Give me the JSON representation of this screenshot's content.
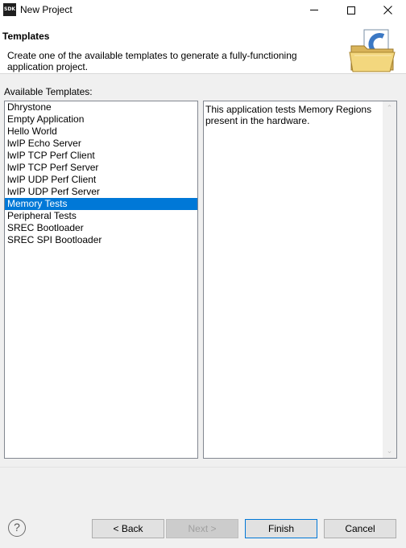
{
  "window": {
    "icon_text": "SDK",
    "title": "New Project"
  },
  "header": {
    "title": "Templates",
    "description": "Create one of the available templates to generate a fully-functioning application project.",
    "icon": "c-project-folder-icon"
  },
  "available_label": "Available Templates:",
  "templates": [
    "Dhrystone",
    "Empty Application",
    "Hello World",
    "lwIP Echo Server",
    "lwIP TCP Perf Client",
    "lwIP TCP Perf Server",
    "lwIP UDP Perf Client",
    "lwIP UDP Perf Server",
    "Memory Tests",
    "Peripheral Tests",
    "SREC Bootloader",
    "SREC SPI Bootloader"
  ],
  "selected_template": "Memory Tests",
  "template_description": "This application tests Memory Regions present in the hardware.",
  "buttons": {
    "help": "?",
    "back": "< Back",
    "next": "Next >",
    "finish": "Finish",
    "cancel": "Cancel"
  },
  "colors": {
    "selection": "#0078d7"
  }
}
